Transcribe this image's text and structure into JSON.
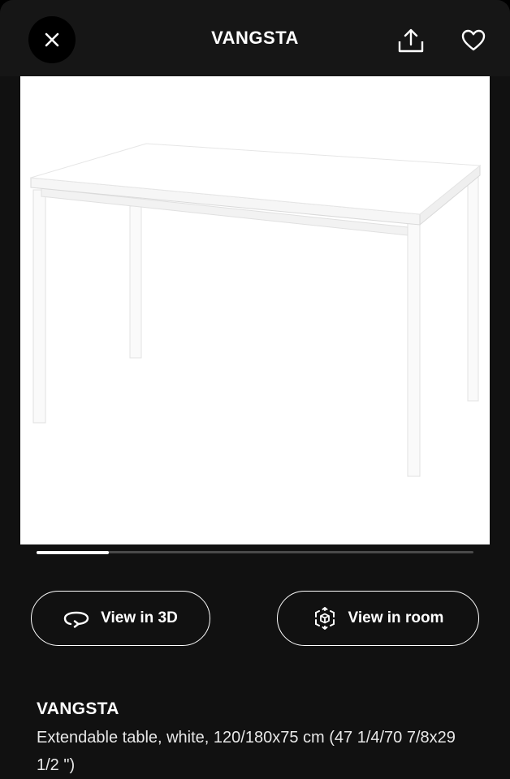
{
  "header": {
    "title": "VANGSTA",
    "close_icon": "close-icon",
    "share_icon": "share-icon",
    "favorite_icon": "heart-icon"
  },
  "gallery": {
    "image_subject": "white-extendable-table",
    "progress_fraction": 0.165
  },
  "actions": {
    "view_3d_label": "View in 3D",
    "view_3d_icon": "rotate-3d-icon",
    "view_room_label": "View in room",
    "view_room_icon": "ar-cube-icon"
  },
  "product": {
    "name": "VANGSTA",
    "description": "Extendable table, white, 120/180x75 cm (47 1/4/70 7/8x29 1/2 \")"
  },
  "colors": {
    "background": "#111111",
    "header": "#161616",
    "accent": "#ffffff"
  }
}
